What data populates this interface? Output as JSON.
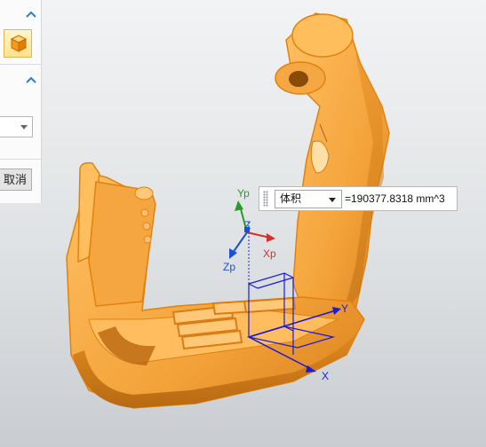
{
  "dialog": {
    "cancel_label": "取消"
  },
  "measure": {
    "type_value": "体积",
    "result": "=190377.8318 mm^3"
  },
  "csys": {
    "yp": "Yp",
    "xp": "Xp",
    "zp": "Zp",
    "z": "Z",
    "x": "X",
    "y": "Y"
  },
  "colors": {
    "model_orange": "#f4a742",
    "model_edge": "#e0820e",
    "axis_x_red": "#d03030",
    "axis_y_green": "#2a9a2a",
    "axis_z_blue": "#1a4fd8",
    "box_blue": "#1a1ad8"
  },
  "icons": [
    "chevron-up-icon",
    "solid-body-icon",
    "dropdown-arrow-icon",
    "grip-icon"
  ]
}
